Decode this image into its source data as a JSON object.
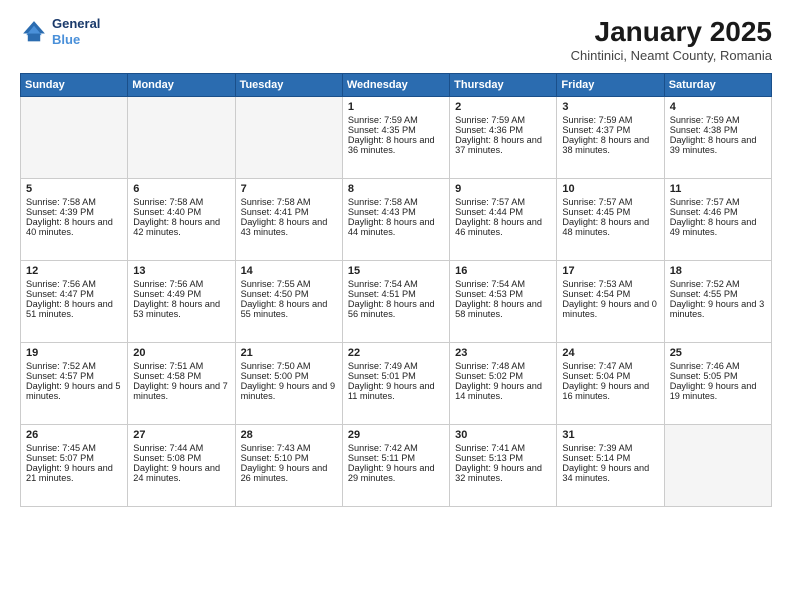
{
  "header": {
    "logo_line1": "General",
    "logo_line2": "Blue",
    "month": "January 2025",
    "location": "Chintinici, Neamt County, Romania"
  },
  "days_of_week": [
    "Sunday",
    "Monday",
    "Tuesday",
    "Wednesday",
    "Thursday",
    "Friday",
    "Saturday"
  ],
  "weeks": [
    [
      {
        "day": "",
        "empty": true
      },
      {
        "day": "",
        "empty": true
      },
      {
        "day": "",
        "empty": true
      },
      {
        "day": "1",
        "sunrise": "7:59 AM",
        "sunset": "4:35 PM",
        "daylight": "8 hours and 36 minutes."
      },
      {
        "day": "2",
        "sunrise": "7:59 AM",
        "sunset": "4:36 PM",
        "daylight": "8 hours and 37 minutes."
      },
      {
        "day": "3",
        "sunrise": "7:59 AM",
        "sunset": "4:37 PM",
        "daylight": "8 hours and 38 minutes."
      },
      {
        "day": "4",
        "sunrise": "7:59 AM",
        "sunset": "4:38 PM",
        "daylight": "8 hours and 39 minutes."
      }
    ],
    [
      {
        "day": "5",
        "sunrise": "7:58 AM",
        "sunset": "4:39 PM",
        "daylight": "8 hours and 40 minutes."
      },
      {
        "day": "6",
        "sunrise": "7:58 AM",
        "sunset": "4:40 PM",
        "daylight": "8 hours and 42 minutes."
      },
      {
        "day": "7",
        "sunrise": "7:58 AM",
        "sunset": "4:41 PM",
        "daylight": "8 hours and 43 minutes."
      },
      {
        "day": "8",
        "sunrise": "7:58 AM",
        "sunset": "4:43 PM",
        "daylight": "8 hours and 44 minutes."
      },
      {
        "day": "9",
        "sunrise": "7:57 AM",
        "sunset": "4:44 PM",
        "daylight": "8 hours and 46 minutes."
      },
      {
        "day": "10",
        "sunrise": "7:57 AM",
        "sunset": "4:45 PM",
        "daylight": "8 hours and 48 minutes."
      },
      {
        "day": "11",
        "sunrise": "7:57 AM",
        "sunset": "4:46 PM",
        "daylight": "8 hours and 49 minutes."
      }
    ],
    [
      {
        "day": "12",
        "sunrise": "7:56 AM",
        "sunset": "4:47 PM",
        "daylight": "8 hours and 51 minutes."
      },
      {
        "day": "13",
        "sunrise": "7:56 AM",
        "sunset": "4:49 PM",
        "daylight": "8 hours and 53 minutes."
      },
      {
        "day": "14",
        "sunrise": "7:55 AM",
        "sunset": "4:50 PM",
        "daylight": "8 hours and 55 minutes."
      },
      {
        "day": "15",
        "sunrise": "7:54 AM",
        "sunset": "4:51 PM",
        "daylight": "8 hours and 56 minutes."
      },
      {
        "day": "16",
        "sunrise": "7:54 AM",
        "sunset": "4:53 PM",
        "daylight": "8 hours and 58 minutes."
      },
      {
        "day": "17",
        "sunrise": "7:53 AM",
        "sunset": "4:54 PM",
        "daylight": "9 hours and 0 minutes."
      },
      {
        "day": "18",
        "sunrise": "7:52 AM",
        "sunset": "4:55 PM",
        "daylight": "9 hours and 3 minutes."
      }
    ],
    [
      {
        "day": "19",
        "sunrise": "7:52 AM",
        "sunset": "4:57 PM",
        "daylight": "9 hours and 5 minutes."
      },
      {
        "day": "20",
        "sunrise": "7:51 AM",
        "sunset": "4:58 PM",
        "daylight": "9 hours and 7 minutes."
      },
      {
        "day": "21",
        "sunrise": "7:50 AM",
        "sunset": "5:00 PM",
        "daylight": "9 hours and 9 minutes."
      },
      {
        "day": "22",
        "sunrise": "7:49 AM",
        "sunset": "5:01 PM",
        "daylight": "9 hours and 11 minutes."
      },
      {
        "day": "23",
        "sunrise": "7:48 AM",
        "sunset": "5:02 PM",
        "daylight": "9 hours and 14 minutes."
      },
      {
        "day": "24",
        "sunrise": "7:47 AM",
        "sunset": "5:04 PM",
        "daylight": "9 hours and 16 minutes."
      },
      {
        "day": "25",
        "sunrise": "7:46 AM",
        "sunset": "5:05 PM",
        "daylight": "9 hours and 19 minutes."
      }
    ],
    [
      {
        "day": "26",
        "sunrise": "7:45 AM",
        "sunset": "5:07 PM",
        "daylight": "9 hours and 21 minutes."
      },
      {
        "day": "27",
        "sunrise": "7:44 AM",
        "sunset": "5:08 PM",
        "daylight": "9 hours and 24 minutes."
      },
      {
        "day": "28",
        "sunrise": "7:43 AM",
        "sunset": "5:10 PM",
        "daylight": "9 hours and 26 minutes."
      },
      {
        "day": "29",
        "sunrise": "7:42 AM",
        "sunset": "5:11 PM",
        "daylight": "9 hours and 29 minutes."
      },
      {
        "day": "30",
        "sunrise": "7:41 AM",
        "sunset": "5:13 PM",
        "daylight": "9 hours and 32 minutes."
      },
      {
        "day": "31",
        "sunrise": "7:39 AM",
        "sunset": "5:14 PM",
        "daylight": "9 hours and 34 minutes."
      },
      {
        "day": "",
        "empty": true
      }
    ]
  ]
}
